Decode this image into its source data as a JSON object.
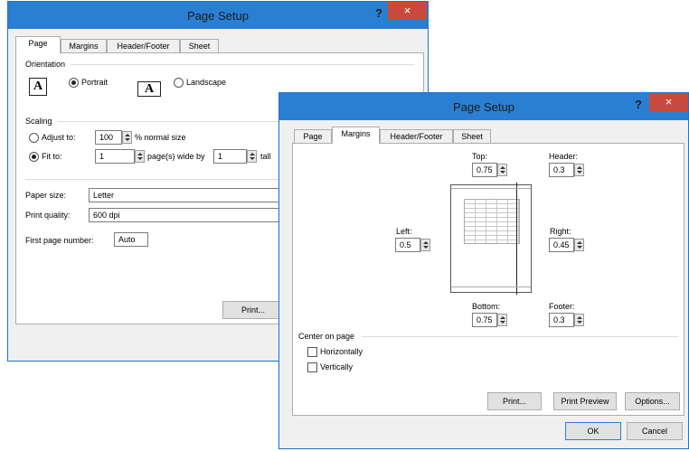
{
  "back_dialog": {
    "title": "Page Setup",
    "help": "?",
    "close": "×",
    "tabs": [
      "Page",
      "Margins",
      "Header/Footer",
      "Sheet"
    ],
    "orientation": {
      "heading": "Orientation",
      "portrait": "Portrait",
      "landscape": "Landscape",
      "icon_letter": "A"
    },
    "scaling": {
      "heading": "Scaling",
      "adjust_to": "Adjust to:",
      "adjust_value": "100",
      "normal_size": "% normal size",
      "fit_to": "Fit to:",
      "wide_value": "1",
      "pages_wide_by": "page(s) wide by",
      "tall_value": "1",
      "tall": "tall"
    },
    "paper_size_label": "Paper size:",
    "paper_size_value": "Letter",
    "print_quality_label": "Print quality:",
    "print_quality_value": "600 dpi",
    "first_page_label": "First page number:",
    "first_page_value": "Auto",
    "print_button": "Print..."
  },
  "front_dialog": {
    "title": "Page Setup",
    "help": "?",
    "close": "×",
    "tabs": [
      "Page",
      "Margins",
      "Header/Footer",
      "Sheet"
    ],
    "margins": {
      "top_label": "Top:",
      "top_value": "0.75",
      "header_label": "Header:",
      "header_value": "0.3",
      "left_label": "Left:",
      "left_value": "0.5",
      "right_label": "Right:",
      "right_value": "0.45",
      "bottom_label": "Bottom:",
      "bottom_value": "0.75",
      "footer_label": "Footer:",
      "footer_value": "0.3"
    },
    "center_on_page": "Center on page",
    "horizontally": "Horizontally",
    "vertically": "Vertically",
    "buttons": {
      "print": "Print...",
      "print_preview": "Print Preview",
      "options": "Options...",
      "ok": "OK",
      "cancel": "Cancel"
    }
  }
}
